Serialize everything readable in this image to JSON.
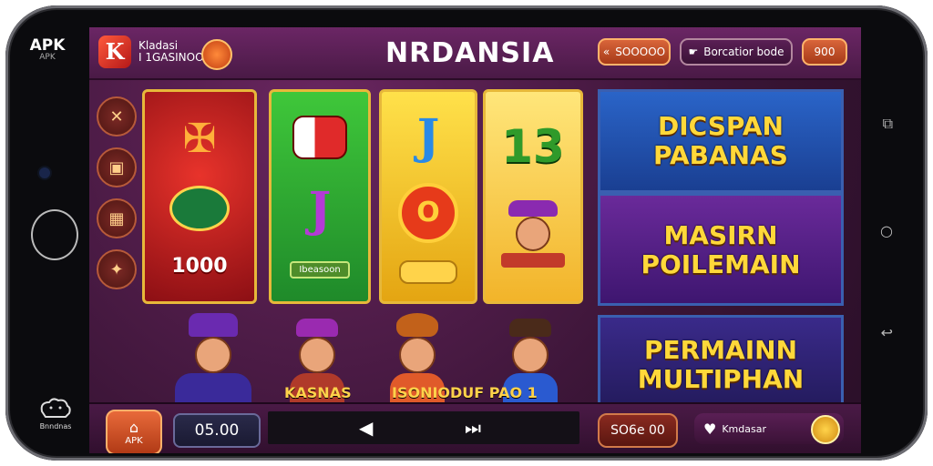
{
  "device": {
    "left_badge": "APK",
    "left_badge_sub": "APK",
    "bottom_logo_text": "Bnndnas"
  },
  "header": {
    "brand_letter": "K",
    "brand_line1": "Kladasi",
    "brand_line2": "I 1GASINOO",
    "title": "NRDANSIA",
    "pill1": "SOOOOO",
    "pill2": "Borcatior bode",
    "pill3": "900"
  },
  "reels": {
    "reel1_value": "1000",
    "reel2_tag": "Ibeasoon"
  },
  "banners": {
    "b1": "DICSPAN PABANAS",
    "b2": "MASIRN POILEMAIN",
    "b3": "PERMAINN MULTIPHAN"
  },
  "captions": {
    "c1": "KASNAS",
    "c2": "ISONIODUF PAO 1"
  },
  "bottombar": {
    "apk_label": "APK",
    "bet_value": "05.00",
    "win_value": "SO6e 00",
    "fav_label": "Kmdasar"
  }
}
